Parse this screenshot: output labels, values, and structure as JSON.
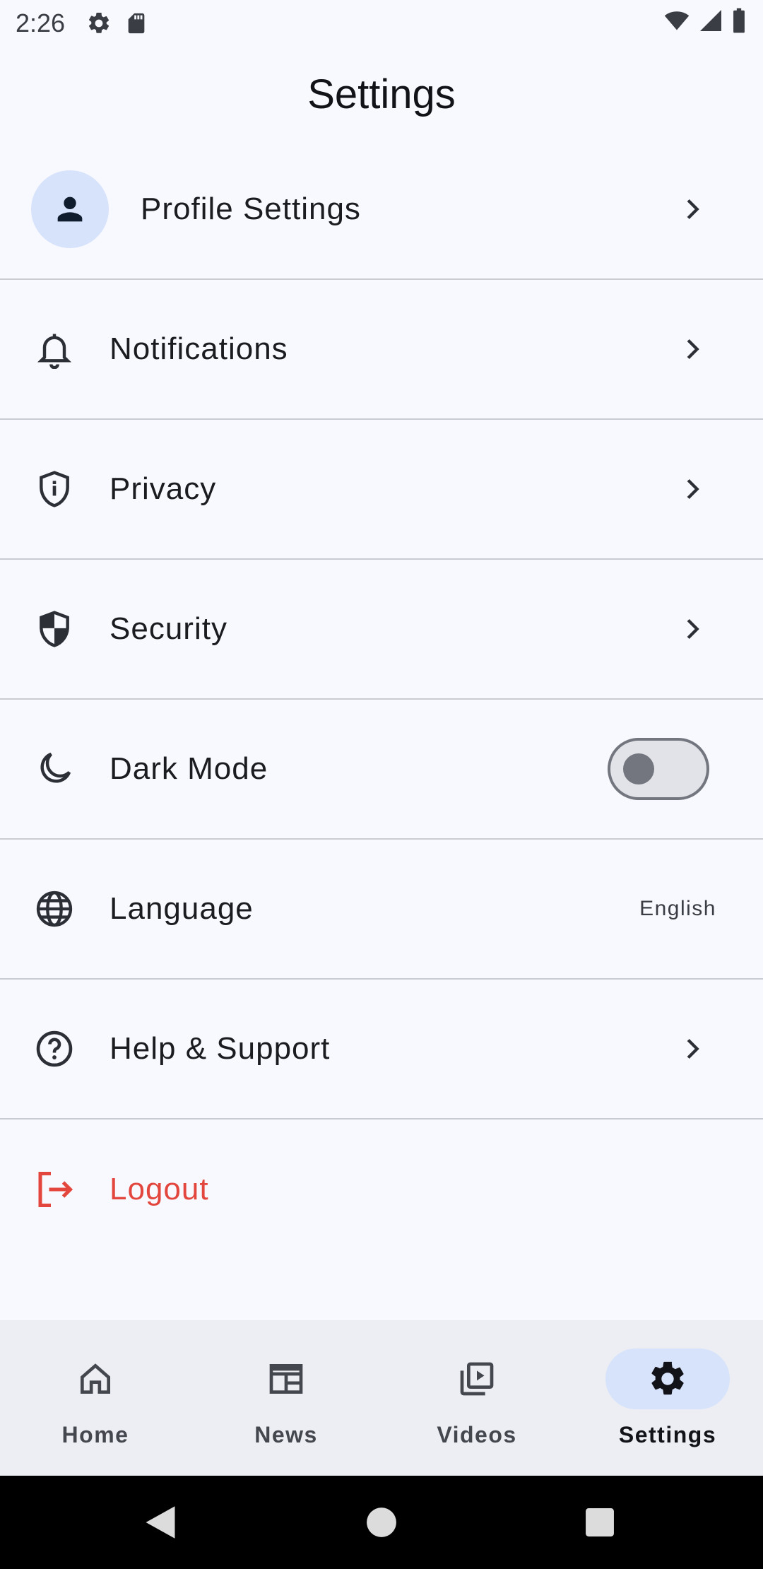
{
  "status_bar": {
    "time": "2:26",
    "icons": [
      "gear-icon",
      "sd-card-icon",
      "wifi-icon",
      "signal-icon",
      "battery-icon"
    ]
  },
  "header": {
    "title": "Settings"
  },
  "settings": {
    "items": [
      {
        "label": "Profile Settings",
        "icon": "person-icon",
        "trailing": "chevron"
      },
      {
        "label": "Notifications",
        "icon": "bell-icon",
        "trailing": "chevron"
      },
      {
        "label": "Privacy",
        "icon": "shield-info-icon",
        "trailing": "chevron"
      },
      {
        "label": "Security",
        "icon": "shield-icon",
        "trailing": "chevron"
      },
      {
        "label": "Dark Mode",
        "icon": "moon-icon",
        "trailing": "toggle",
        "toggle_on": false
      },
      {
        "label": "Language",
        "icon": "globe-icon",
        "trailing": "value",
        "value": "English"
      },
      {
        "label": "Help & Support",
        "icon": "help-circle-icon",
        "trailing": "chevron"
      },
      {
        "label": "Logout",
        "icon": "logout-icon",
        "trailing": "none",
        "color": "#e2463c"
      }
    ]
  },
  "bottom_nav": {
    "items": [
      {
        "label": "Home",
        "icon": "home-icon"
      },
      {
        "label": "News",
        "icon": "news-icon"
      },
      {
        "label": "Videos",
        "icon": "video-library-icon"
      },
      {
        "label": "Settings",
        "icon": "gear-icon"
      }
    ],
    "selected": "Settings"
  },
  "colors": {
    "background": "#f8f9ff",
    "accent_container": "#d7e3fb",
    "logout": "#e2463c",
    "nav_background": "#edeef3"
  }
}
